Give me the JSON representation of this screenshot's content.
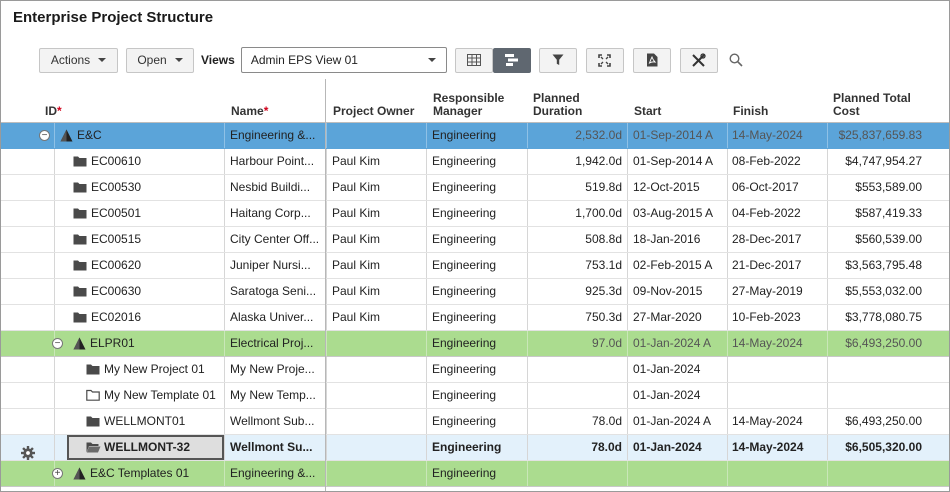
{
  "app": {
    "title": "Enterprise Project Structure"
  },
  "toolbar": {
    "actions_label": "Actions",
    "open_label": "Open",
    "views_label": "Views",
    "views_selected": "Admin EPS View 01"
  },
  "columns": {
    "id": "ID",
    "name": "Name",
    "owner": "Project Owner",
    "mgr_1": "Responsible",
    "mgr_2": "Manager",
    "dur_1": "Planned",
    "dur_2": "Duration",
    "start": "Start",
    "finish": "Finish",
    "cost_1": "Planned Total",
    "cost_2": "Cost",
    "required_mark": "*"
  },
  "rows": [
    {
      "id": "E&C",
      "name": "Engineering &...",
      "owner": "",
      "mgr": "Engineering",
      "dur": "2,532.0d",
      "start": "01-Sep-2014 A",
      "finish": "14-May-2024",
      "cost": "$25,837,659.83"
    },
    {
      "id": "EC00610",
      "name": "Harbour Point...",
      "owner": "Paul Kim",
      "mgr": "Engineering",
      "dur": "1,942.0d",
      "start": "01-Sep-2014 A",
      "finish": "08-Feb-2022",
      "cost": "$4,747,954.27"
    },
    {
      "id": "EC00530",
      "name": "Nesbid Buildi...",
      "owner": "Paul Kim",
      "mgr": "Engineering",
      "dur": "519.8d",
      "start": "12-Oct-2015",
      "finish": "06-Oct-2017",
      "cost": "$553,589.00"
    },
    {
      "id": "EC00501",
      "name": "Haitang Corp...",
      "owner": "Paul Kim",
      "mgr": "Engineering",
      "dur": "1,700.0d",
      "start": "03-Aug-2015 A",
      "finish": "04-Feb-2022",
      "cost": "$587,419.33"
    },
    {
      "id": "EC00515",
      "name": "City Center Off...",
      "owner": "Paul Kim",
      "mgr": "Engineering",
      "dur": "508.8d",
      "start": "18-Jan-2016",
      "finish": "28-Dec-2017",
      "cost": "$560,539.00"
    },
    {
      "id": "EC00620",
      "name": "Juniper Nursi...",
      "owner": "Paul Kim",
      "mgr": "Engineering",
      "dur": "753.1d",
      "start": "02-Feb-2015 A",
      "finish": "21-Dec-2017",
      "cost": "$3,563,795.48"
    },
    {
      "id": "EC00630",
      "name": "Saratoga Seni...",
      "owner": "Paul Kim",
      "mgr": "Engineering",
      "dur": "925.3d",
      "start": "09-Nov-2015",
      "finish": "27-May-2019",
      "cost": "$5,553,032.00"
    },
    {
      "id": "EC02016",
      "name": "Alaska Univer...",
      "owner": "Paul Kim",
      "mgr": "Engineering",
      "dur": "750.3d",
      "start": "27-Mar-2020",
      "finish": "10-Feb-2023",
      "cost": "$3,778,080.75"
    },
    {
      "id": "ELPR01",
      "name": "Electrical Proj...",
      "owner": "",
      "mgr": "Engineering",
      "dur": "97.0d",
      "start": "01-Jan-2024 A",
      "finish": "14-May-2024",
      "cost": "$6,493,250.00"
    },
    {
      "id": "My New Project 01",
      "name": "My New Proje...",
      "owner": "",
      "mgr": "Engineering",
      "dur": "",
      "start": "01-Jan-2024",
      "finish": "",
      "cost": ""
    },
    {
      "id": "My New Template 01",
      "name": "My New Temp...",
      "owner": "",
      "mgr": "Engineering",
      "dur": "",
      "start": "01-Jan-2024",
      "finish": "",
      "cost": ""
    },
    {
      "id": "WELLMONT01",
      "name": "Wellmont Sub...",
      "owner": "",
      "mgr": "Engineering",
      "dur": "78.0d",
      "start": "01-Jan-2024 A",
      "finish": "14-May-2024",
      "cost": "$6,493,250.00"
    },
    {
      "id": "WELLMONT-32",
      "name": "Wellmont Su...",
      "owner": "",
      "mgr": "Engineering",
      "dur": "78.0d",
      "start": "01-Jan-2024",
      "finish": "14-May-2024",
      "cost": "$6,505,320.00"
    },
    {
      "id": "E&C Templates 01",
      "name": "Engineering &...",
      "owner": "",
      "mgr": "Engineering",
      "dur": "",
      "start": "",
      "finish": "",
      "cost": ""
    }
  ],
  "row_meta": [
    {
      "kind": "eps",
      "state": "selected",
      "toggle": "⊖",
      "icon": "eps-icon"
    },
    {
      "kind": "project",
      "state": "normal",
      "icon": "folder-icon"
    },
    {
      "kind": "project",
      "state": "normal",
      "icon": "folder-icon"
    },
    {
      "kind": "project",
      "state": "normal",
      "icon": "folder-icon"
    },
    {
      "kind": "project",
      "state": "normal",
      "icon": "folder-icon"
    },
    {
      "kind": "project",
      "state": "normal",
      "icon": "folder-icon"
    },
    {
      "kind": "project",
      "state": "normal",
      "icon": "folder-icon"
    },
    {
      "kind": "project",
      "state": "normal",
      "icon": "folder-icon"
    },
    {
      "kind": "eps",
      "state": "green",
      "toggle": "⊖",
      "icon": "eps-icon"
    },
    {
      "kind": "project",
      "state": "normal",
      "icon": "folder-icon"
    },
    {
      "kind": "project",
      "state": "normal",
      "icon": "folder-outline-icon"
    },
    {
      "kind": "project",
      "state": "normal",
      "icon": "folder-icon"
    },
    {
      "kind": "project",
      "state": "current",
      "icon": "folder-open-icon"
    },
    {
      "kind": "eps",
      "state": "green",
      "toggle": "⊕",
      "icon": "eps-icon"
    }
  ],
  "colors": {
    "selected_row": "#5ba4d9",
    "eps_row": "#abdc8f",
    "current_row": "#e3f1fb",
    "required": "#d0021b"
  }
}
